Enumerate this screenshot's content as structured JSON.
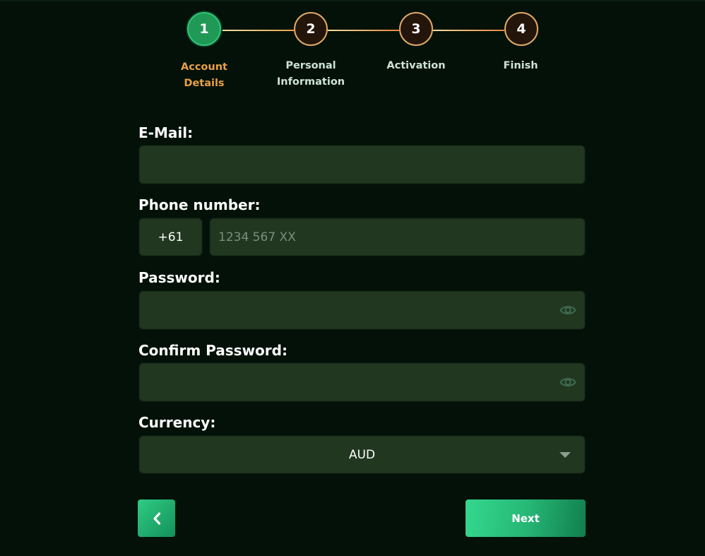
{
  "stepper": {
    "steps": [
      {
        "number": "1",
        "label": "Account\nDetails"
      },
      {
        "number": "2",
        "label": "Personal\nInformation"
      },
      {
        "number": "3",
        "label": "Activation"
      },
      {
        "number": "4",
        "label": "Finish"
      }
    ],
    "active_step": 1
  },
  "form": {
    "email": {
      "label": "E-Mail:",
      "value": "",
      "placeholder": ""
    },
    "phone": {
      "label": "Phone number:",
      "prefix": "+61",
      "value": "",
      "placeholder": "1234 567 XX"
    },
    "password": {
      "label": "Password:",
      "value": "",
      "icon": "eye-icon"
    },
    "confirm_password": {
      "label": "Confirm Password:",
      "value": "",
      "icon": "eye-icon"
    },
    "currency": {
      "label": "Currency:",
      "selected": "AUD",
      "icon": "caret-down-icon"
    }
  },
  "nav": {
    "back_icon": "chevron-left-icon",
    "next_label": "Next"
  },
  "colors": {
    "background": "#031109",
    "input_bg": "#213720",
    "accent_green": "#26b876",
    "accent_orange": "#e8a046",
    "step_border": "#e0a868"
  }
}
